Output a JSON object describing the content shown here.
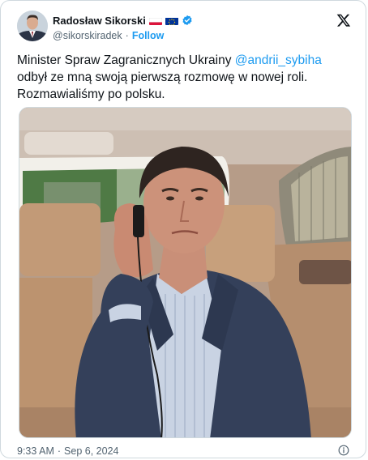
{
  "author": {
    "name": "Radosław Sikorski",
    "handle": "@sikorskiradek",
    "separator": "·",
    "follow_label": "Follow",
    "flags": [
      "poland-flag-icon",
      "eu-flag-icon"
    ],
    "verified": true
  },
  "tweet": {
    "text_before": "Minister Spraw Zagranicznych Ukrainy ",
    "mention": "@andrii_sybiha",
    "text_after": "\nodbył ze mną swoją pierwszą rozmowę w nowej roli.\nRozmawialiśmy po polsku."
  },
  "footer": {
    "time": "9:33 AM",
    "separator": "·",
    "date": "Sep 6, 2024"
  },
  "colors": {
    "accent": "#1d9bf0",
    "text": "#0f1419",
    "muted": "#536471",
    "verified": "#1d9bf0"
  },
  "icons": [
    "x-logo-icon",
    "verified-badge-icon",
    "info-icon"
  ]
}
